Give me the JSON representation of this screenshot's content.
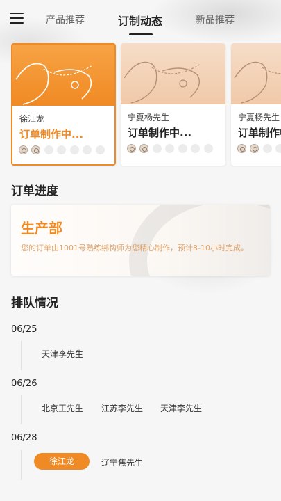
{
  "header": {
    "tabs": [
      {
        "label": "产品推荐",
        "active": false
      },
      {
        "label": "订制动态",
        "active": true
      },
      {
        "label": "新品推荐",
        "active": false
      }
    ]
  },
  "cards": [
    {
      "name": "徐江龙",
      "status": "订单制作中...",
      "selected": true,
      "progress_done": 2,
      "progress_total": 7
    },
    {
      "name": "宁夏杨先生",
      "status": "订单制作中...",
      "selected": false,
      "progress_done": 2,
      "progress_total": 7
    },
    {
      "name": "宁夏杨先生",
      "status": "订单制作中...",
      "selected": false,
      "progress_done": 2,
      "progress_total": 7
    }
  ],
  "order_progress": {
    "title": "订单进度",
    "department": "生产部",
    "description": "您的订单由1001号熟练绑钩师为您精心制作，预计8-10小时完成。"
  },
  "queue": {
    "title": "排队情况",
    "groups": [
      {
        "date": "06/25",
        "names": [
          {
            "label": "天津李先生",
            "me": false
          }
        ]
      },
      {
        "date": "06/26",
        "names": [
          {
            "label": "北京王先生",
            "me": false
          },
          {
            "label": "江苏李先生",
            "me": false
          },
          {
            "label": "天津李先生",
            "me": false
          }
        ]
      },
      {
        "date": "06/28",
        "names": [
          {
            "label": "徐江龙",
            "me": true
          },
          {
            "label": "辽宁焦先生",
            "me": false
          }
        ]
      }
    ]
  },
  "colors": {
    "accent": "#f08a24",
    "text": "#222222",
    "muted": "#666666"
  },
  "icons": {
    "menu": "hamburger-menu-icon",
    "progress_step": "ring-icon"
  }
}
